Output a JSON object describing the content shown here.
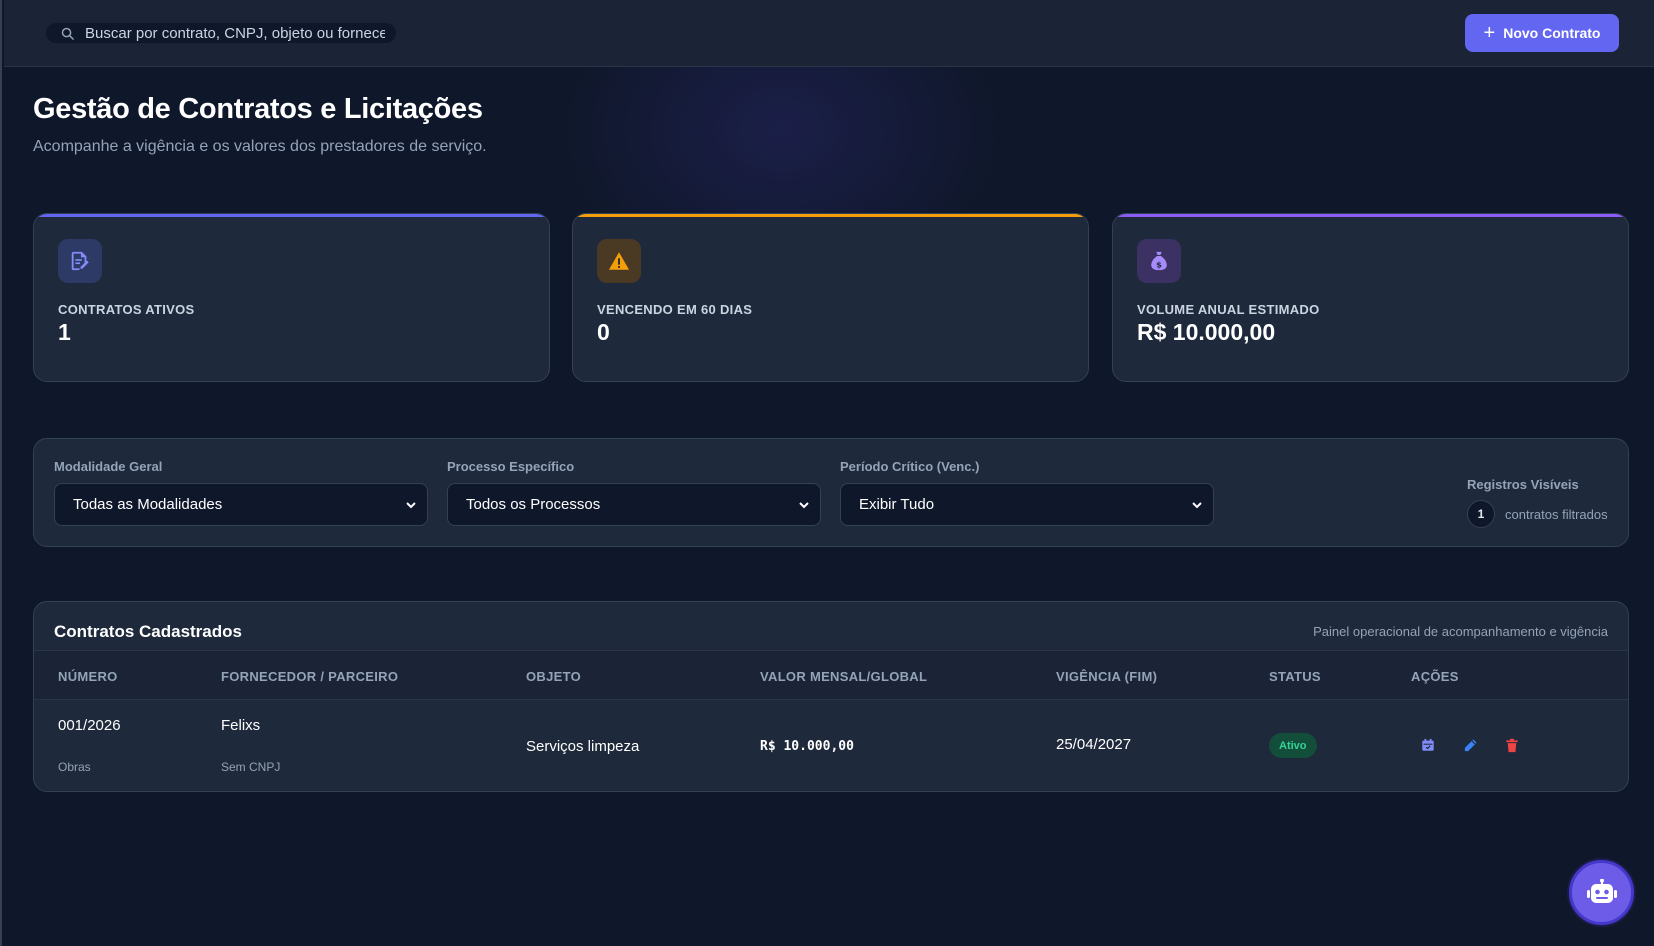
{
  "topbar": {
    "search_placeholder": "Buscar por contrato, CNPJ, objeto ou fornecedor...",
    "search_icon": "search-icon",
    "new_button_label": "Novo Contrato",
    "new_button_icon": "plus-icon"
  },
  "header": {
    "title": "Gestão de Contratos e Licitações",
    "subtitle": "Acompanhe a vigência e os valores dos prestadores de serviço."
  },
  "stats": [
    {
      "label": "CONTRATOS ATIVOS",
      "value": "1",
      "icon": "file-edit-icon",
      "accent": "#6366f1"
    },
    {
      "label": "VENCENDO EM 60 DIAS",
      "value": "0",
      "icon": "warning-icon",
      "accent": "#f59e0b"
    },
    {
      "label": "VOLUME ANUAL ESTIMADO",
      "value": "R$ 10.000,00",
      "icon": "money-bag-icon",
      "accent": "#8b5cf6"
    }
  ],
  "filters": {
    "modalidade": {
      "label": "Modalidade Geral",
      "selected": "Todas as Modalidades"
    },
    "processo": {
      "label": "Processo Específico",
      "selected": "Todos os Processos"
    },
    "periodo": {
      "label": "Período Crítico (Venc.)",
      "selected": "Exibir Tudo"
    },
    "registros": {
      "label": "Registros Visíveis",
      "count": "1",
      "text": "contratos filtrados"
    }
  },
  "table": {
    "title": "Contratos Cadastrados",
    "note": "Painel operacional de acompanhamento e vigência",
    "columns": [
      "NÚMERO",
      "FORNECEDOR / PARCEIRO",
      "OBJETO",
      "VALOR MENSAL/GLOBAL",
      "VIGÊNCIA (FIM)",
      "STATUS",
      "AÇÕES"
    ],
    "rows": [
      {
        "numero": "001/2026",
        "modalidade": "Obras",
        "fornecedor": "Felixs",
        "cnpj": "Sem CNPJ",
        "objeto": "Serviços limpeza",
        "valor": "R$ 10.000,00",
        "vigencia": "25/04/2027",
        "status": "Ativo",
        "actions": [
          "calendar-icon",
          "pencil-icon",
          "trash-icon"
        ]
      }
    ]
  },
  "colors": {
    "accent": "#6366f1",
    "background": "#0f172a",
    "surface": "#1e293b",
    "status_active": "#34d399",
    "danger": "#ef4444"
  },
  "assistant": {
    "icon": "robot-icon"
  }
}
